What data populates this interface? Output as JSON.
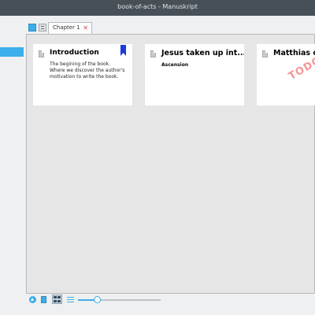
{
  "window": {
    "title": "book-of-acts - Manuskript"
  },
  "editor": {
    "tabs": [
      {
        "label": "Chapter 1"
      }
    ]
  },
  "cards": [
    {
      "title": "Introduction",
      "summary": "The begining of the book. Where we discover the author's motivation to write the book.",
      "bookmarked": true
    },
    {
      "title": "Jesus taken up int...",
      "subtitle": "Ascension"
    },
    {
      "title": "Matthias ch",
      "stamp": "TODO"
    }
  ],
  "zoom": {
    "value": 0.24
  },
  "colors": {
    "accent": "#3daee9",
    "bookmark": "#1d3adb",
    "stamp": "#ef6b6b"
  },
  "icons": {
    "tab_close": "✕"
  }
}
